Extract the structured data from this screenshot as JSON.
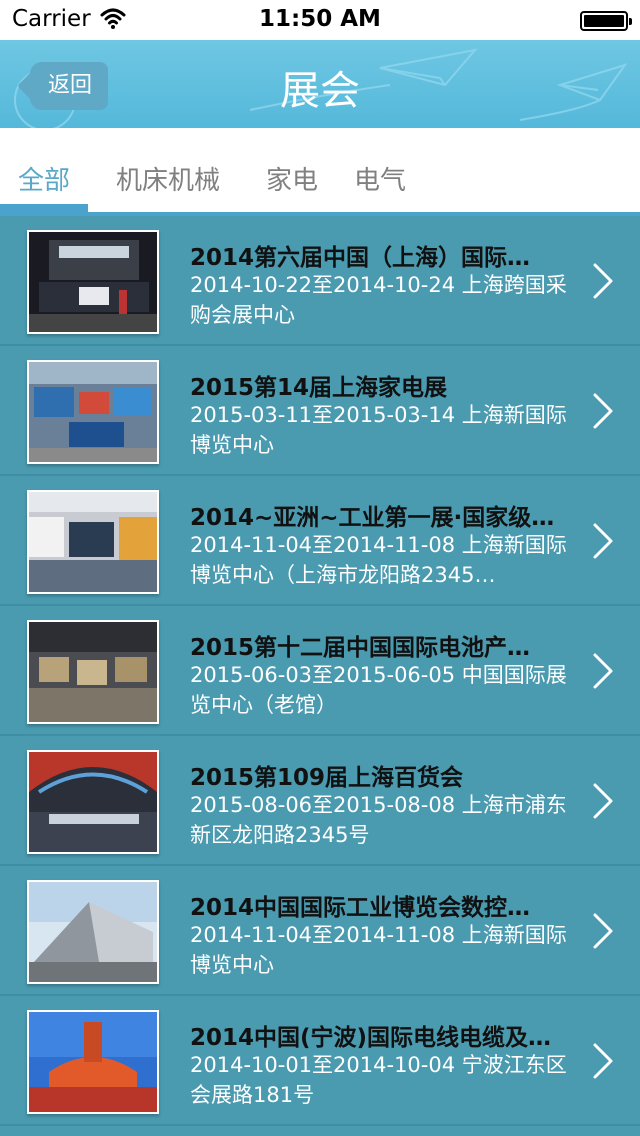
{
  "status_bar": {
    "carrier": "Carrier",
    "time": "11:50 AM"
  },
  "nav": {
    "back_label": "返回",
    "title": "展会"
  },
  "tabs": [
    {
      "label": "全部",
      "active": true
    },
    {
      "label": "机床机械",
      "active": false
    },
    {
      "label": "家电",
      "active": false
    },
    {
      "label": "电气",
      "active": false
    }
  ],
  "colors": {
    "nav_bar": "#5bbde0",
    "list_bg": "#4a9ab0",
    "tab_accent": "#4aa3cc",
    "title_text": "#111111",
    "desc_text": "#ffffff"
  },
  "icons": {
    "wifi": "wifi-icon",
    "battery": "battery-icon",
    "back": "back-arrow-icon",
    "chevron": "chevron-right-icon"
  },
  "exhibitions": [
    {
      "title": "2014第六届中国（上海）国际…",
      "desc": "2014-10-22至2014-10-24 上海跨国采购会展中心"
    },
    {
      "title": "2015第14届上海家电展",
      "desc": "2015-03-11至2015-03-14 上海新国际博览中心"
    },
    {
      "title": "2014~亚洲~工业第一展·国家级…",
      "desc": "2014-11-04至2014-11-08 上海新国际博览中心（上海市龙阳路2345…"
    },
    {
      "title": "2015第十二届中国国际电池产…",
      "desc": "2015-06-03至2015-06-05 中国国际展览中心（老馆）"
    },
    {
      "title": "2015第109届上海百货会",
      "desc": "2015-08-06至2015-08-08 上海市浦东新区龙阳路2345号"
    },
    {
      "title": "2014中国国际工业博览会数控…",
      "desc": "2014-11-04至2014-11-08 上海新国际博览中心"
    },
    {
      "title": "2014中国(宁波)国际电线电缆及…",
      "desc": "2014-10-01至2014-10-04 宁波江东区会展路181号"
    }
  ]
}
